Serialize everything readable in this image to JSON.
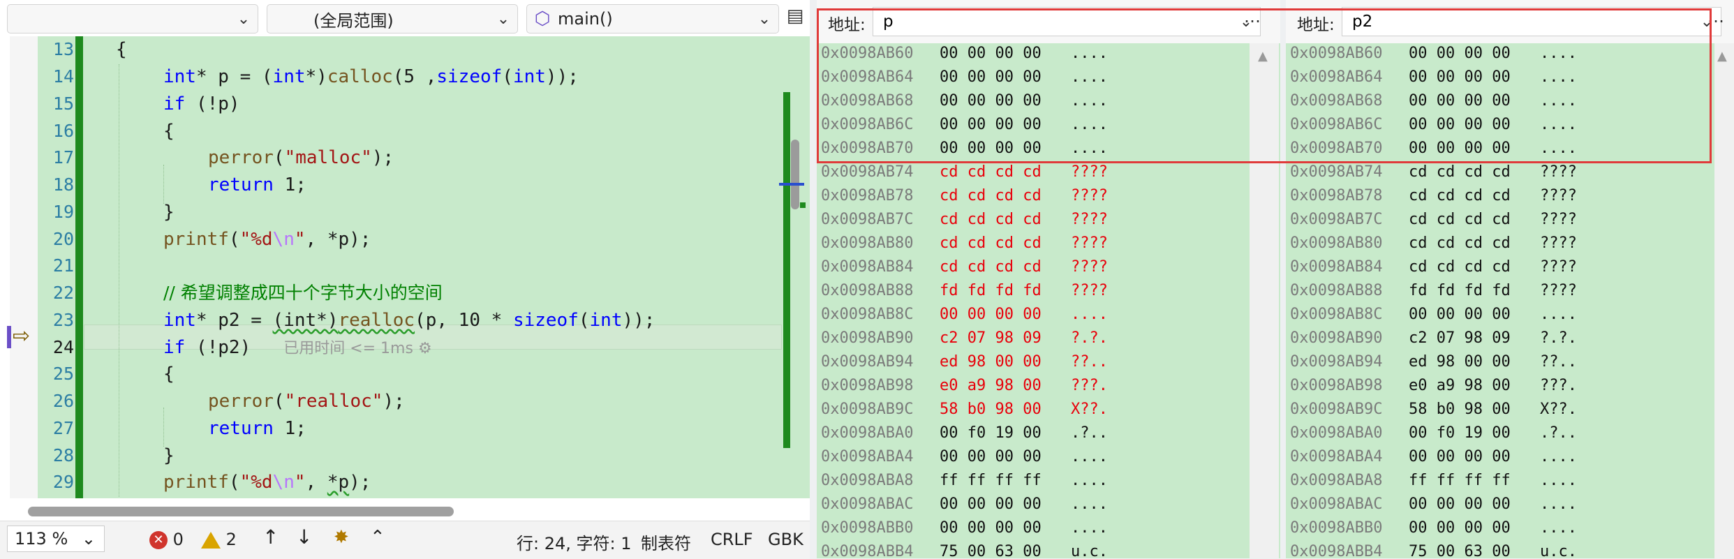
{
  "editor": {
    "dropdowns": {
      "project": "",
      "scope": "(全局范围)",
      "function": "main()"
    },
    "inline_hint": "已用时间 <= 1ms",
    "code_lines": [
      {
        "num": "13"
      },
      {
        "num": "14"
      },
      {
        "num": "15"
      },
      {
        "num": "16"
      },
      {
        "num": "17"
      },
      {
        "num": "18"
      },
      {
        "num": "19"
      },
      {
        "num": "20"
      },
      {
        "num": "21"
      },
      {
        "num": "22"
      },
      {
        "num": "23"
      },
      {
        "num": "24"
      },
      {
        "num": "25"
      },
      {
        "num": "26"
      },
      {
        "num": "27"
      },
      {
        "num": "28"
      },
      {
        "num": "29"
      }
    ],
    "code": {
      "l13": "{",
      "l14_int": "int",
      "l14_a": "* p = (",
      "l14_int2": "int",
      "l14_b": "*)",
      "l14_fn": "calloc",
      "l14_c": "(5 ,",
      "l14_kw": "sizeof",
      "l14_d": "(",
      "l14_int3": "int",
      "l14_e": "));",
      "l15_kw": "if",
      "l15_rest": " (!p)",
      "l16": "{",
      "l17_fn": "perror",
      "l17_a": "(",
      "l17_str": "\"malloc\"",
      "l17_b": ");",
      "l18_kw": "return",
      "l18_rest": " 1;",
      "l19": "}",
      "l20_fn": "printf",
      "l20_a": "(",
      "l20_s1": "\"%d",
      "l20_esc": "\\n",
      "l20_s2": "\"",
      "l20_b": ", *p);",
      "l22_comment": "// 希望调整成四十个字节大小的空间",
      "l23_int": "int",
      "l23_a": "* p2 = ",
      "l23_cast": "(int*)",
      "l23_fn": "realloc",
      "l23_b": "(p, 10 * ",
      "l23_kw": "sizeof",
      "l23_c": "(",
      "l23_int2": "int",
      "l23_d": "));",
      "l24_kw": "if",
      "l24_rest": " (!p2)",
      "l25": "{",
      "l26_fn": "perror",
      "l26_a": "(",
      "l26_str": "\"realloc\"",
      "l26_b": ");",
      "l27_kw": "return",
      "l27_rest": " 1;",
      "l28": "}",
      "l29_fn": "printf",
      "l29_a": "(",
      "l29_s1": "\"%d",
      "l29_esc": "\\n",
      "l29_s2": "\"",
      "l29_b": ", ",
      "l29_p": "*p",
      "l29_c": ");"
    }
  },
  "statusbar": {
    "zoom": "113 %",
    "errors": "0",
    "warnings": "2",
    "position": "行: 24, 字符: 1",
    "indent": "制表符",
    "line_ending": "CRLF",
    "encoding": "GBK"
  },
  "memory1": {
    "address_label": "地址:",
    "address_value": "p",
    "more": "…"
  },
  "memory2": {
    "address_label": "地址:",
    "address_value": "p2",
    "more": "…"
  },
  "memory_rows": [
    {
      "addr": "0x0098AB60",
      "hex": "00 00 00 00",
      "ascii": "....",
      "red": false
    },
    {
      "addr": "0x0098AB64",
      "hex": "00 00 00 00",
      "ascii": "....",
      "red": false
    },
    {
      "addr": "0x0098AB68",
      "hex": "00 00 00 00",
      "ascii": "....",
      "red": false
    },
    {
      "addr": "0x0098AB6C",
      "hex": "00 00 00 00",
      "ascii": "....",
      "red": false
    },
    {
      "addr": "0x0098AB70",
      "hex": "00 00 00 00",
      "ascii": "....",
      "red": false
    },
    {
      "addr": "0x0098AB74",
      "hex": "cd cd cd cd",
      "ascii": "????",
      "red": true
    },
    {
      "addr": "0x0098AB78",
      "hex": "cd cd cd cd",
      "ascii": "????",
      "red": true
    },
    {
      "addr": "0x0098AB7C",
      "hex": "cd cd cd cd",
      "ascii": "????",
      "red": true
    },
    {
      "addr": "0x0098AB80",
      "hex": "cd cd cd cd",
      "ascii": "????",
      "red": true
    },
    {
      "addr": "0x0098AB84",
      "hex": "cd cd cd cd",
      "ascii": "????",
      "red": true
    },
    {
      "addr": "0x0098AB88",
      "hex": "fd fd fd fd",
      "ascii": "????",
      "red": true
    },
    {
      "addr": "0x0098AB8C",
      "hex": "00 00 00 00",
      "ascii": "....",
      "red": true
    },
    {
      "addr": "0x0098AB90",
      "hex": "c2 07 98 09",
      "ascii": "?.?.",
      "red": true
    },
    {
      "addr": "0x0098AB94",
      "hex": "ed 98 00 00",
      "ascii": "??..",
      "red": true
    },
    {
      "addr": "0x0098AB98",
      "hex": "e0 a9 98 00",
      "ascii": "???.",
      "red": true
    },
    {
      "addr": "0x0098AB9C",
      "hex": "58 b0 98 00",
      "ascii": "X??.",
      "red": true
    },
    {
      "addr": "0x0098ABA0",
      "hex": "00 f0 19 00",
      "ascii": ".?..",
      "red": false
    },
    {
      "addr": "0x0098ABA4",
      "hex": "00 00 00 00",
      "ascii": "....",
      "red": false
    },
    {
      "addr": "0x0098ABA8",
      "hex": "ff ff ff ff",
      "ascii": "....",
      "red": false
    },
    {
      "addr": "0x0098ABAC",
      "hex": "00 00 00 00",
      "ascii": "....",
      "red": false
    },
    {
      "addr": "0x0098ABB0",
      "hex": "00 00 00 00",
      "ascii": "....",
      "red": false
    },
    {
      "addr": "0x0098ABB4",
      "hex": "75 00 63 00",
      "ascii": "u.c.",
      "red": false
    }
  ]
}
